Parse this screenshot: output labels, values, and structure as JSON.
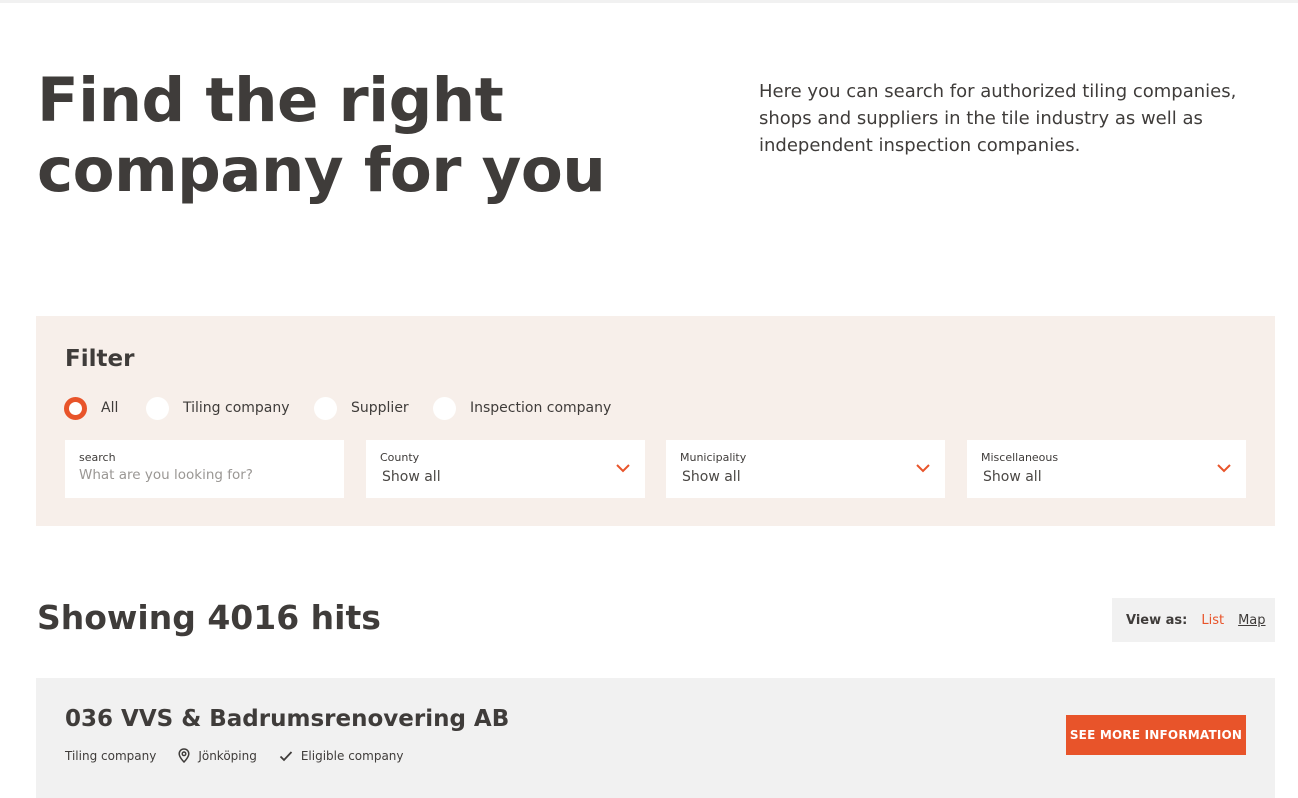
{
  "hero": {
    "title": "Find the right company for you",
    "description": "Here you can search for authorized tiling companies, shops and suppliers in the tile industry as well as independent inspection companies."
  },
  "filter": {
    "title": "Filter",
    "radios": [
      {
        "label": "All",
        "checked": true
      },
      {
        "label": "Tiling company",
        "checked": false
      },
      {
        "label": "Supplier",
        "checked": false
      },
      {
        "label": "Inspection company",
        "checked": false
      }
    ],
    "search": {
      "label": "search",
      "placeholder": "What are you looking for?",
      "value": ""
    },
    "county": {
      "label": "County",
      "value": "Show all"
    },
    "municipality": {
      "label": "Municipality",
      "value": "Show all"
    },
    "miscellaneous": {
      "label": "Miscellaneous",
      "value": "Show all"
    }
  },
  "results": {
    "hits_text": "Showing 4016 hits",
    "view_as": {
      "label": "View as:",
      "list": "List",
      "map": "Map",
      "selected": "List"
    },
    "items": [
      {
        "name": "036 VVS & Badrumsrenovering AB",
        "type": "Tiling company",
        "location": "Jönköping",
        "eligibility": "Eligible company",
        "button_label": "SEE MORE INFORMATION"
      }
    ]
  },
  "colors": {
    "accent": "#e8542a",
    "text": "#3f3c3a",
    "filter_bg": "#f7efea",
    "card_bg": "#f1f1f1"
  },
  "icons": {
    "select_chevron": "chevron-down-icon",
    "location": "map-pin-icon",
    "eligible": "check-icon"
  }
}
